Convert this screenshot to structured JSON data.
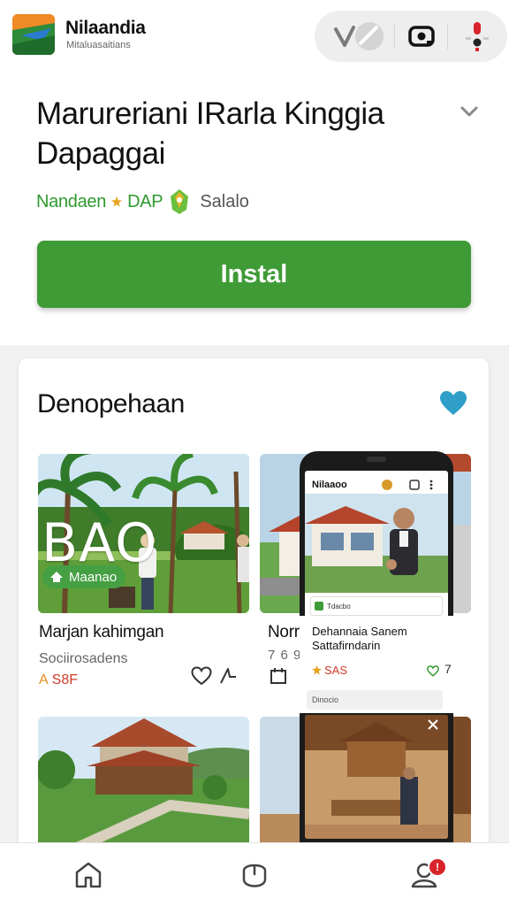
{
  "header": {
    "brand_name": "Nilaandia",
    "brand_sub": "Mitaluasaitians",
    "actions": [
      {
        "icon": "check-tag-icon"
      },
      {
        "icon": "camera-icon"
      },
      {
        "icon": "alert-icon"
      }
    ]
  },
  "hero": {
    "title_line1": "Marureriani IRarla Kinggia",
    "title_line2": "Dapaggai",
    "developer": "Nandaen",
    "developer_tag": "DAP",
    "secondary": "Salalo",
    "install_label": "Instal"
  },
  "section": {
    "title": "Denopehaan",
    "items": [
      {
        "thumb_label": "BAO",
        "chip_label": "Maanao",
        "title": "Marjan kahimgan",
        "subtitle": "Sociirosadens",
        "price": "S8F",
        "price_prefix": "A"
      },
      {
        "title": "Norr",
        "subtitle": "7 6 9 3",
        "price": "",
        "side_count": "7"
      }
    ]
  },
  "phone_mock": {
    "brand": "Nilaaoo",
    "caption_line1": "Dehannaia Sanem",
    "caption_line2": "Sattafirndarin",
    "price": "SAS",
    "count": "7",
    "field_label": "Dinocio",
    "chip_label": "Tdacbo"
  },
  "bottom_nav": {
    "items": [
      {
        "icon": "home-icon"
      },
      {
        "icon": "mouse-icon"
      },
      {
        "icon": "profile-icon",
        "badge": "!"
      }
    ]
  },
  "colors": {
    "accent_green": "#3f9b36",
    "heart_blue": "#2f9fc9",
    "badge_red": "#d8242b"
  }
}
